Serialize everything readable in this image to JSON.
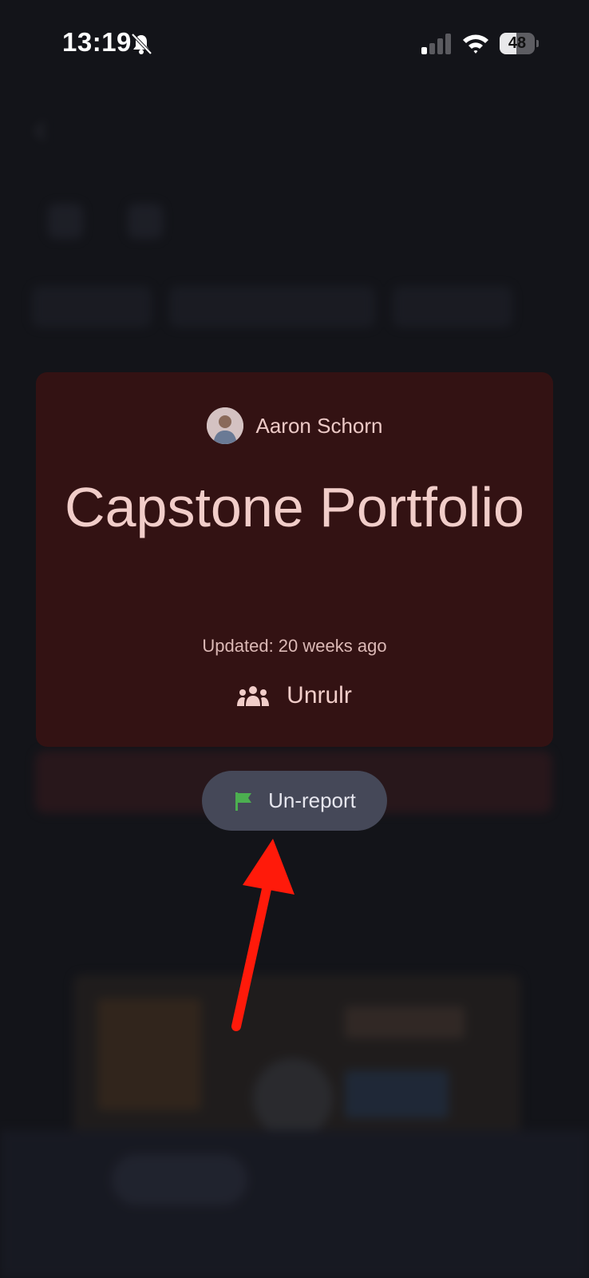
{
  "status_bar": {
    "time": "13:19",
    "battery_level": "48",
    "icons": [
      "bell-slash-icon",
      "cellular-signal-icon",
      "wifi-icon",
      "battery-icon"
    ]
  },
  "card": {
    "author_name": "Aaron Schorn",
    "title": "Capstone Portfolio",
    "updated": "Updated: 20 weeks ago",
    "group_name": "Unrulr",
    "background_color": "#331213",
    "text_color": "#f1cdc9"
  },
  "popup": {
    "unreport_label": "Un-report",
    "flag_color": "#4caf50"
  },
  "annotation": {
    "arrow_color": "#ff1a0a"
  }
}
